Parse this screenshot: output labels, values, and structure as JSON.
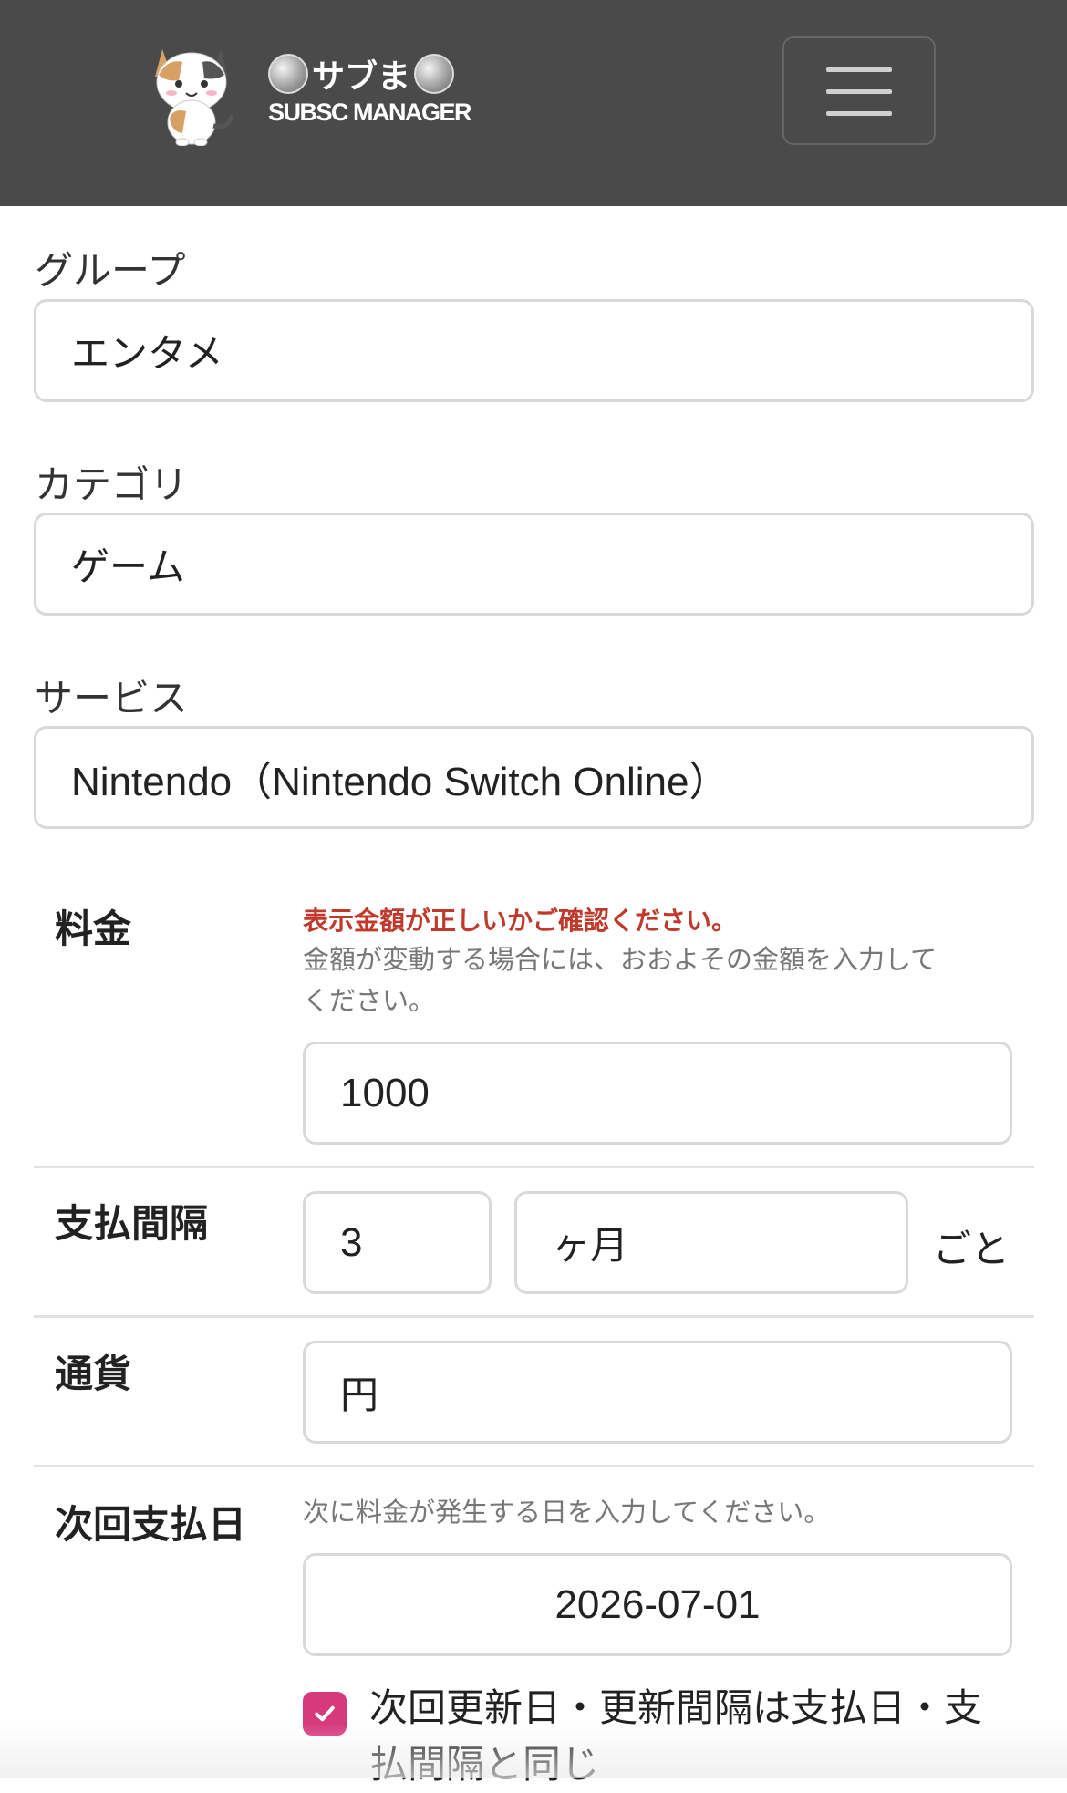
{
  "header": {
    "brand_name": "サブま",
    "brand_sub": "SUBSC MANAGER"
  },
  "group": {
    "label": "グループ",
    "value": "エンタメ"
  },
  "category": {
    "label": "カテゴリ",
    "value": "ゲーム"
  },
  "service": {
    "label": "サービス",
    "value": "Nintendo（Nintendo Switch Online）"
  },
  "price": {
    "label": "料金",
    "warning": "表示金額が正しいかご確認ください。",
    "hint_line1": "金額が変動する場合には、おおよその金額を入力して",
    "hint_line2": "ください。",
    "value": "1000"
  },
  "interval": {
    "label": "支払間隔",
    "number": "3",
    "unit": "ヶ月",
    "suffix": "ごと"
  },
  "currency": {
    "label": "通貨",
    "value": "円"
  },
  "next_payment": {
    "label": "次回支払日",
    "hint": "次に料金が発生する日を入力してください。",
    "value": "2026-07-01"
  },
  "same_as_payment": {
    "checked": true,
    "label": "次回更新日・更新間隔は支払日・支払間隔と同じ"
  },
  "colors": {
    "header_bg": "#4a4a4a",
    "warning": "#c0392b",
    "checkbox": "#d63a7d"
  }
}
